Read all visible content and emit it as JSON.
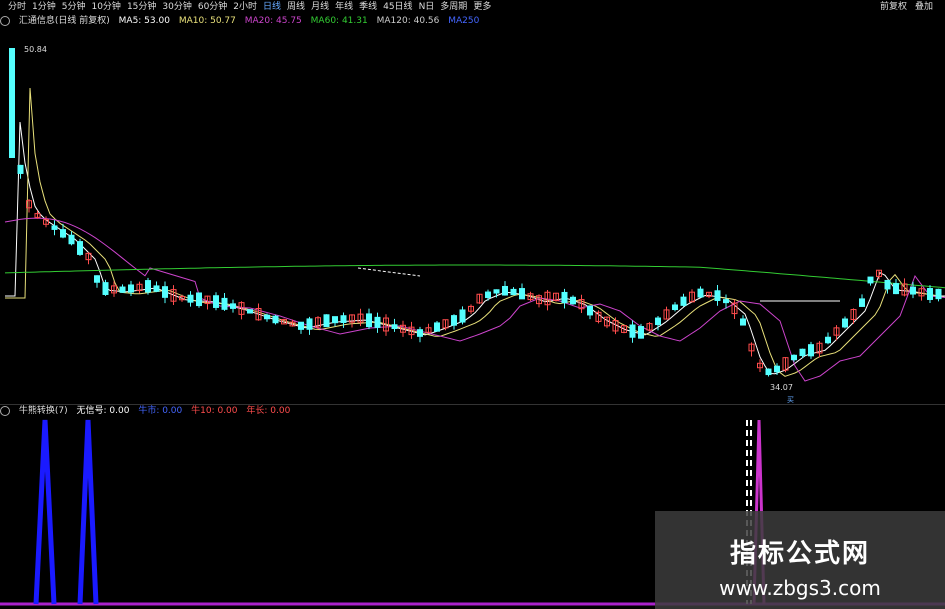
{
  "toolbar": {
    "tabs": [
      "分时",
      "1分钟",
      "5分钟",
      "10分钟",
      "15分钟",
      "30分钟",
      "60分钟",
      "2小时",
      "日线",
      "周线",
      "月线",
      "年线",
      "季线",
      "45日线",
      "N日",
      "多周期",
      "更多"
    ],
    "active": "日线",
    "right_tabs": [
      "前复权",
      "叠加"
    ]
  },
  "info": {
    "title": "汇通信息(日线 前复权)",
    "ma5": "MA5: 53.00",
    "ma10": "MA10: 50.77",
    "ma20": "MA20: 45.75",
    "ma60": "MA60: 41.31",
    "ma120": "MA120: 40.56",
    "ma250": "MA250"
  },
  "price_labels": {
    "high": "50.84",
    "low": "34.07",
    "low_tag": "买"
  },
  "indicator": {
    "name": "牛熊转换(7)",
    "label1": "无信号: 0.00",
    "label2": "牛市: 0.00",
    "label3": "牛10: 0.00",
    "label4": "年长: 0.00"
  },
  "watermark": {
    "title": "指标公式网",
    "url": "www.zbgs3.com"
  },
  "colors": {
    "up": "#ff4d4d",
    "down": "#5ff",
    "ma5": "#ffffff",
    "ma10": "#e8e07a",
    "ma20": "#cc44cc",
    "ma60": "#33cc33",
    "ind_blue": "#1a1aff",
    "ind_magenta": "#cc33cc"
  }
}
